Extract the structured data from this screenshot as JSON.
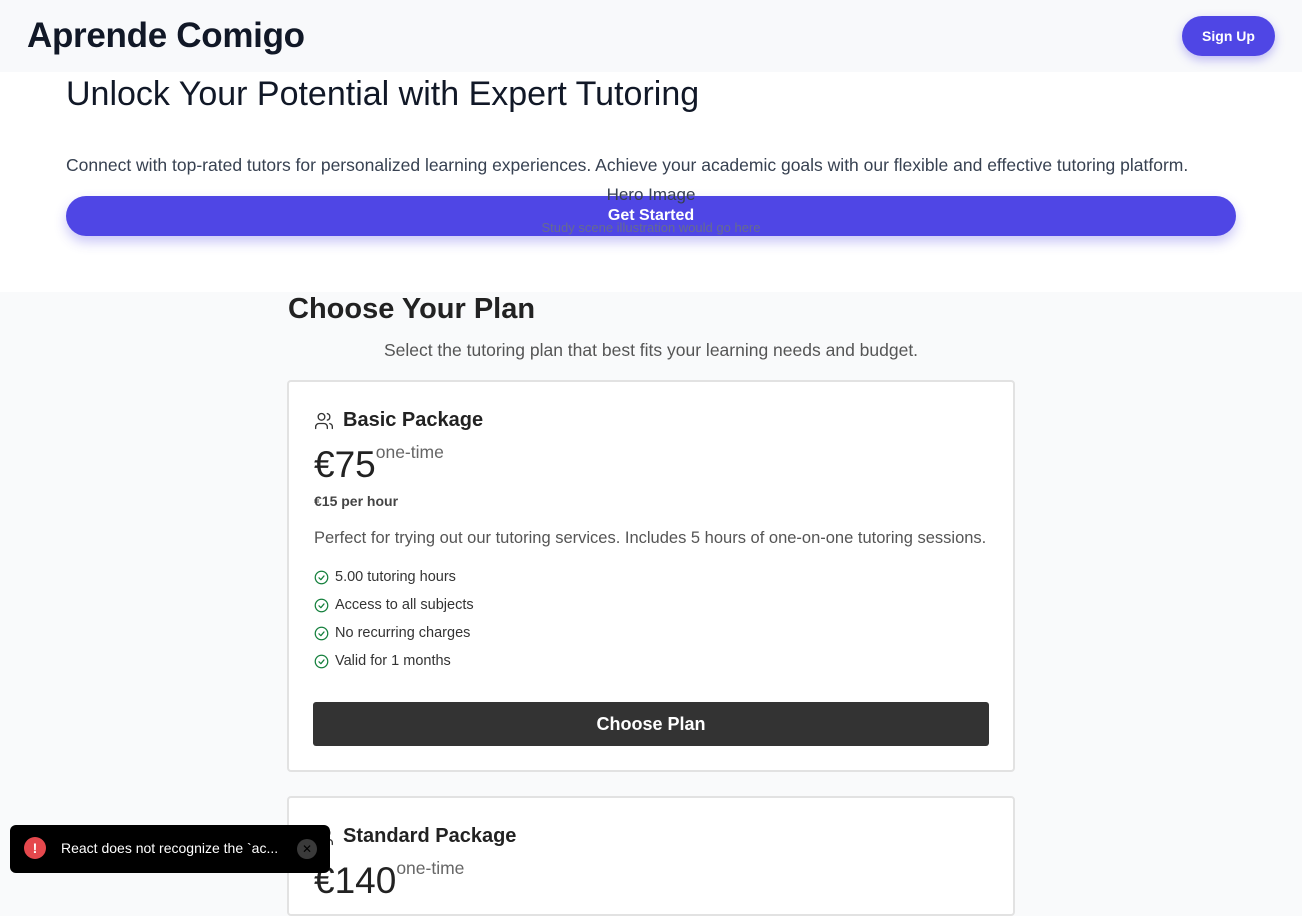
{
  "header": {
    "brand": "Aprende Comigo",
    "signup_label": "Sign Up"
  },
  "hero": {
    "title": "Unlock Your Potential with Expert Tutoring",
    "description": "Connect with top-rated tutors for personalized learning experiences. Achieve your academic goals with our flexible and effective tutoring platform.",
    "cta_label": "Get Started",
    "image_title": "Hero Image",
    "image_caption": "Study scene illustration would go here"
  },
  "plans": {
    "title": "Choose Your Plan",
    "subtitle": "Select the tutoring plan that best fits your learning needs and budget.",
    "items": [
      {
        "name": "Basic Package",
        "icon": "users-icon",
        "price": "€75",
        "period": "one-time",
        "per_hour": "€15 per hour",
        "description": "Perfect for trying out our tutoring services. Includes 5 hours of one-on-one tutoring sessions.",
        "features": [
          "5.00 tutoring hours",
          "Access to all subjects",
          "No recurring charges",
          "Valid for 1 months"
        ],
        "cta_label": "Choose Plan"
      },
      {
        "name": "Standard Package",
        "icon": "users-icon",
        "price": "€140",
        "period": "one-time"
      }
    ]
  },
  "toast": {
    "message": "React does not recognize the `ac...",
    "icon": "error-icon",
    "close_icon": "close-icon"
  },
  "colors": {
    "accent": "#4f46e5",
    "check": "#15803d",
    "dark_button": "#333333",
    "error": "#e5484d"
  }
}
